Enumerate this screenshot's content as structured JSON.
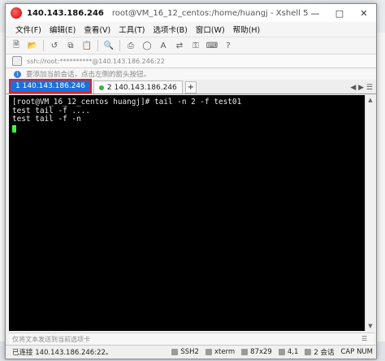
{
  "window": {
    "ip": "140.143.186.246",
    "title_rest": "root@VM_16_12_centos:/home/huangj - Xshell 5"
  },
  "menubar": [
    "文件(F)",
    "编辑(E)",
    "查看(V)",
    "工具(T)",
    "选项卡(B)",
    "窗口(W)",
    "帮助(H)"
  ],
  "address": "ssh://root:**********@140.143.186.246:22",
  "hint": "要添加当前会话，点击左侧的箭头按钮。",
  "tabs": {
    "active_label": "1 140.143.186.246",
    "inactive_label": "2 140.143.186.246",
    "plus": "+"
  },
  "terminal": {
    "lines": [
      "[root@VM_16_12_centos huangj]# tail -n 2 -f test01",
      "test tail -f ....",
      "test tail -f -n"
    ]
  },
  "inputbar": "仅将文本发送到当前选项卡",
  "status": {
    "connection": "已连接 140.143.186.246:22。",
    "protocol": "SSH2",
    "term": "xterm",
    "size": "87x29",
    "pos": "4,1",
    "sessions": "2 会话",
    "keys": "CAP NUM"
  }
}
